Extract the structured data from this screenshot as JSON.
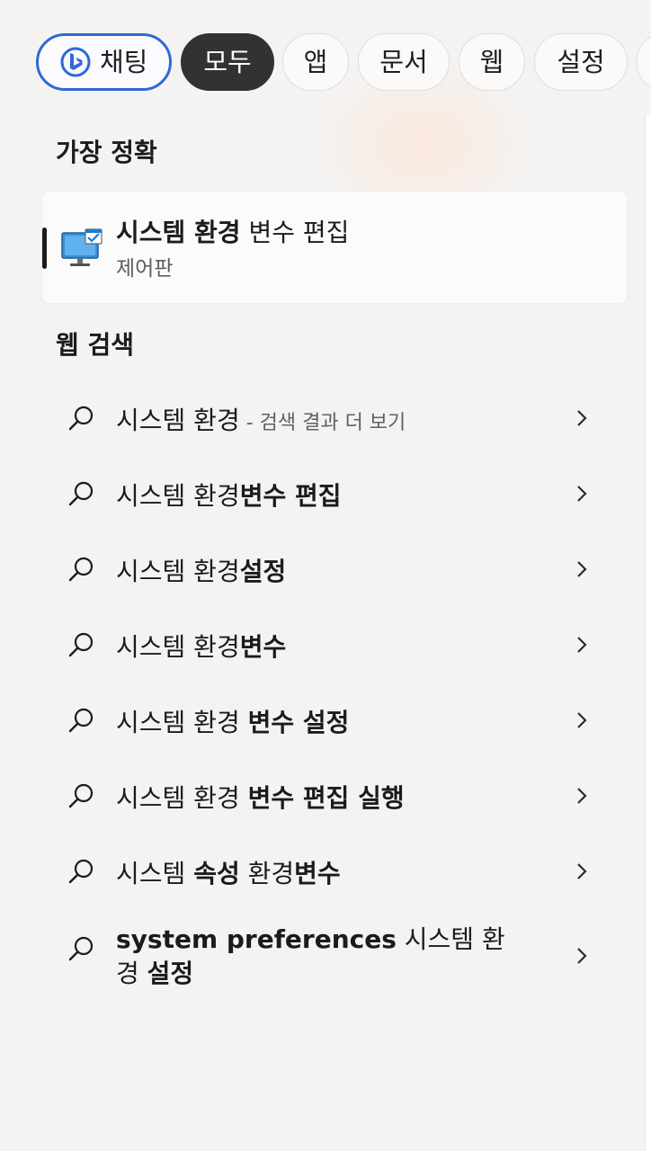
{
  "filters": {
    "chat": "채팅",
    "all": "모두",
    "apps": "앱",
    "documents": "문서",
    "web": "웹",
    "settings": "설정"
  },
  "best_match": {
    "title": "가장 정확",
    "item": {
      "name_bold": "시스템 환경",
      "name_rest": " 변수 편집",
      "subtitle": "제어판",
      "icon": "system-properties-monitor-icon"
    }
  },
  "web_search": {
    "title": "웹 검색",
    "results": [
      {
        "normal": "시스템 환경",
        "bold": "",
        "suffix": " - 검색 결과 더 보기"
      },
      {
        "normal": "시스템 환경",
        "bold": "변수 편집"
      },
      {
        "normal": "시스템 환경",
        "bold": "설정"
      },
      {
        "normal": "시스템 환경",
        "bold": "변수"
      },
      {
        "normal": "시스템 환경 ",
        "bold": "변수 설정"
      },
      {
        "normal": "시스템 환경 ",
        "bold": "변수 편집 실행"
      },
      {
        "normal": "시스템 ",
        "bold": "속성",
        "normal2": " 환경",
        "bold2": "변수"
      },
      {
        "bold": "system preferences",
        "normal": " 시스템 환경 ",
        "bold2": "설정"
      }
    ]
  },
  "colors": {
    "accent": "#2f68d8",
    "selected_pill": "#323232",
    "background": "#f3f3f3"
  }
}
